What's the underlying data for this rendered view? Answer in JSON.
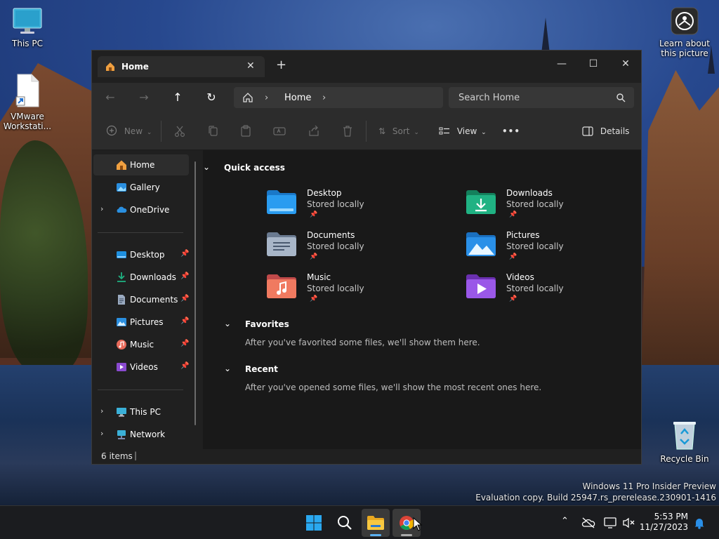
{
  "desktop": {
    "icons": {
      "this_pc": "This PC",
      "vmware": "VMware Workstati...",
      "learn": "Learn about this picture",
      "recycle_bin": "Recycle Bin"
    },
    "watermark_line1": "Windows 11 Pro Insider Preview",
    "watermark_line2": "Evaluation copy. Build 25947.rs_prerelease.230901-1416"
  },
  "window": {
    "tab_title": "Home",
    "tab_close": "✕",
    "new_tab": "+",
    "controls": {
      "minimize": "—",
      "maximize": "☐",
      "close": "✕"
    }
  },
  "navbar": {
    "back": "←",
    "forward": "→",
    "up": "↑",
    "refresh": "↻",
    "address": {
      "segment": "Home"
    },
    "search_placeholder": "Search Home"
  },
  "commandbar": {
    "new_label": "New",
    "sort_label": "Sort",
    "view_label": "View",
    "more_label": "•••",
    "details_label": "Details"
  },
  "sidebar": {
    "top": [
      {
        "label": "Home",
        "icon": "home-icon",
        "selected": true
      },
      {
        "label": "Gallery",
        "icon": "gallery-icon"
      },
      {
        "label": "OneDrive",
        "icon": "onedrive-icon",
        "expandable": true
      }
    ],
    "pinned": [
      {
        "label": "Desktop",
        "icon": "desktop-folder-icon"
      },
      {
        "label": "Downloads",
        "icon": "downloads-folder-icon"
      },
      {
        "label": "Documents",
        "icon": "documents-folder-icon"
      },
      {
        "label": "Pictures",
        "icon": "pictures-folder-icon"
      },
      {
        "label": "Music",
        "icon": "music-folder-icon"
      },
      {
        "label": "Videos",
        "icon": "videos-folder-icon"
      }
    ],
    "bottom": [
      {
        "label": "This PC",
        "icon": "this-pc-icon",
        "expandable": true
      },
      {
        "label": "Network",
        "icon": "network-icon",
        "expandable": true
      }
    ]
  },
  "main": {
    "quick_access": {
      "title": "Quick access",
      "items": [
        {
          "name": "Desktop",
          "sub": "Stored locally",
          "icon": "desktop-folder-icon",
          "color": "#1e90e0"
        },
        {
          "name": "Downloads",
          "sub": "Stored locally",
          "icon": "downloads-folder-icon",
          "color": "#1fa67a"
        },
        {
          "name": "Documents",
          "sub": "Stored locally",
          "icon": "documents-folder-icon",
          "color": "#8a9ab0"
        },
        {
          "name": "Pictures",
          "sub": "Stored locally",
          "icon": "pictures-folder-icon",
          "color": "#2a8fe0"
        },
        {
          "name": "Music",
          "sub": "Stored locally",
          "icon": "music-folder-icon",
          "color": "#e86a5a"
        },
        {
          "name": "Videos",
          "sub": "Stored locally",
          "icon": "videos-folder-icon",
          "color": "#8a4ad0"
        }
      ]
    },
    "favorites": {
      "title": "Favorites",
      "empty_text": "After you've favorited some files, we'll show them here."
    },
    "recent": {
      "title": "Recent",
      "empty_text": "After you've opened some files, we'll show the most recent ones here."
    }
  },
  "statusbar": {
    "items_count": "6 items"
  },
  "taskbar": {
    "clock_time": "5:53 PM",
    "clock_date": "11/27/2023"
  }
}
